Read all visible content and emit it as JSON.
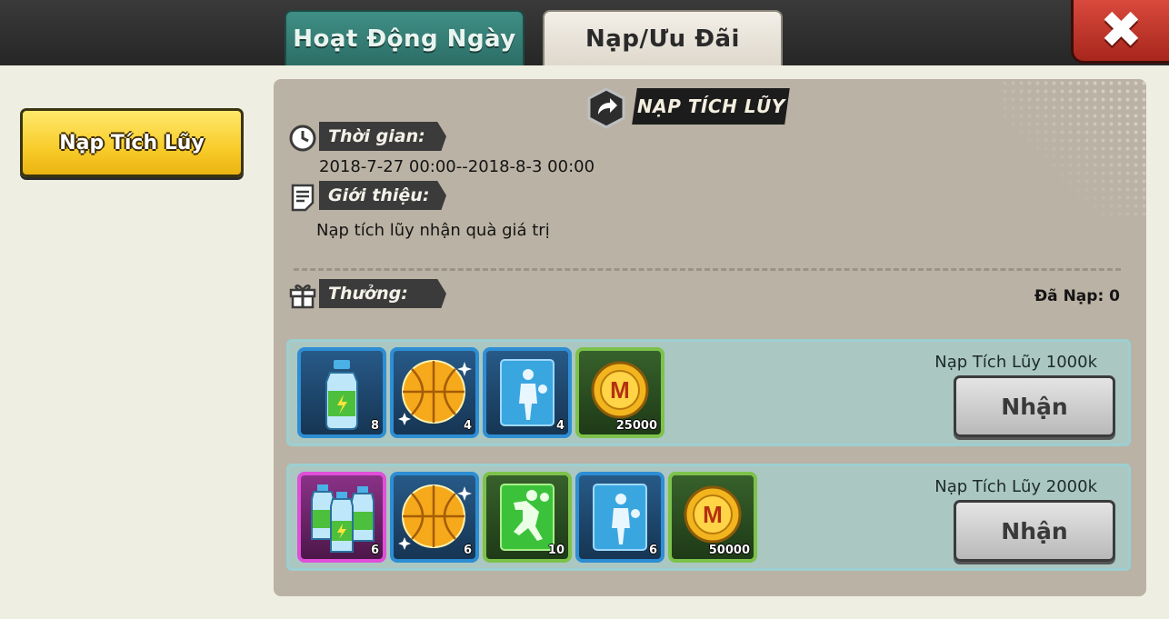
{
  "tabs": [
    {
      "label": "Hoạt Động Ngày",
      "active": false
    },
    {
      "label": "Nạp/Ưu Đãi",
      "active": true
    }
  ],
  "sidebar": {
    "items": [
      {
        "label": "Nạp Tích Lũy",
        "selected": true
      }
    ]
  },
  "panel": {
    "title": "NẠP TÍCH LŨY",
    "time_label": "Thời gian:",
    "time_value": "2018-7-27 00:00--2018-8-3 00:00",
    "intro_label": "Giới thiệu:",
    "intro_value": "Nạp tích lũy nhận quà giá trị",
    "reward_label": "Thưởng:",
    "recharged": "Đã Nạp: 0"
  },
  "tiers": [
    {
      "label": "Nạp Tích Lũy 1000k",
      "button": "Nhận",
      "items": [
        {
          "icon": "energy-drink-icon",
          "qty": "8",
          "rarity": "blue"
        },
        {
          "icon": "gold-basketball-icon",
          "qty": "4",
          "rarity": "blue"
        },
        {
          "icon": "player-card-icon",
          "qty": "4",
          "rarity": "blue"
        },
        {
          "icon": "gold-coin-icon",
          "qty": "25000",
          "rarity": "green"
        }
      ]
    },
    {
      "label": "Nạp Tích Lũy 2000k",
      "button": "Nhận",
      "items": [
        {
          "icon": "energy-drink-pack-icon",
          "qty": "6",
          "rarity": "purple"
        },
        {
          "icon": "gold-basketball-icon",
          "qty": "6",
          "rarity": "blue"
        },
        {
          "icon": "dunk-card-icon",
          "qty": "10",
          "rarity": "green"
        },
        {
          "icon": "player-card-icon",
          "qty": "6",
          "rarity": "blue"
        },
        {
          "icon": "gold-coin-icon",
          "qty": "50000",
          "rarity": "green"
        }
      ]
    }
  ],
  "colors": {
    "accent_yellow": "#f8cc2a",
    "tab_teal": "#2c6e66",
    "close_red": "#c2352a"
  }
}
